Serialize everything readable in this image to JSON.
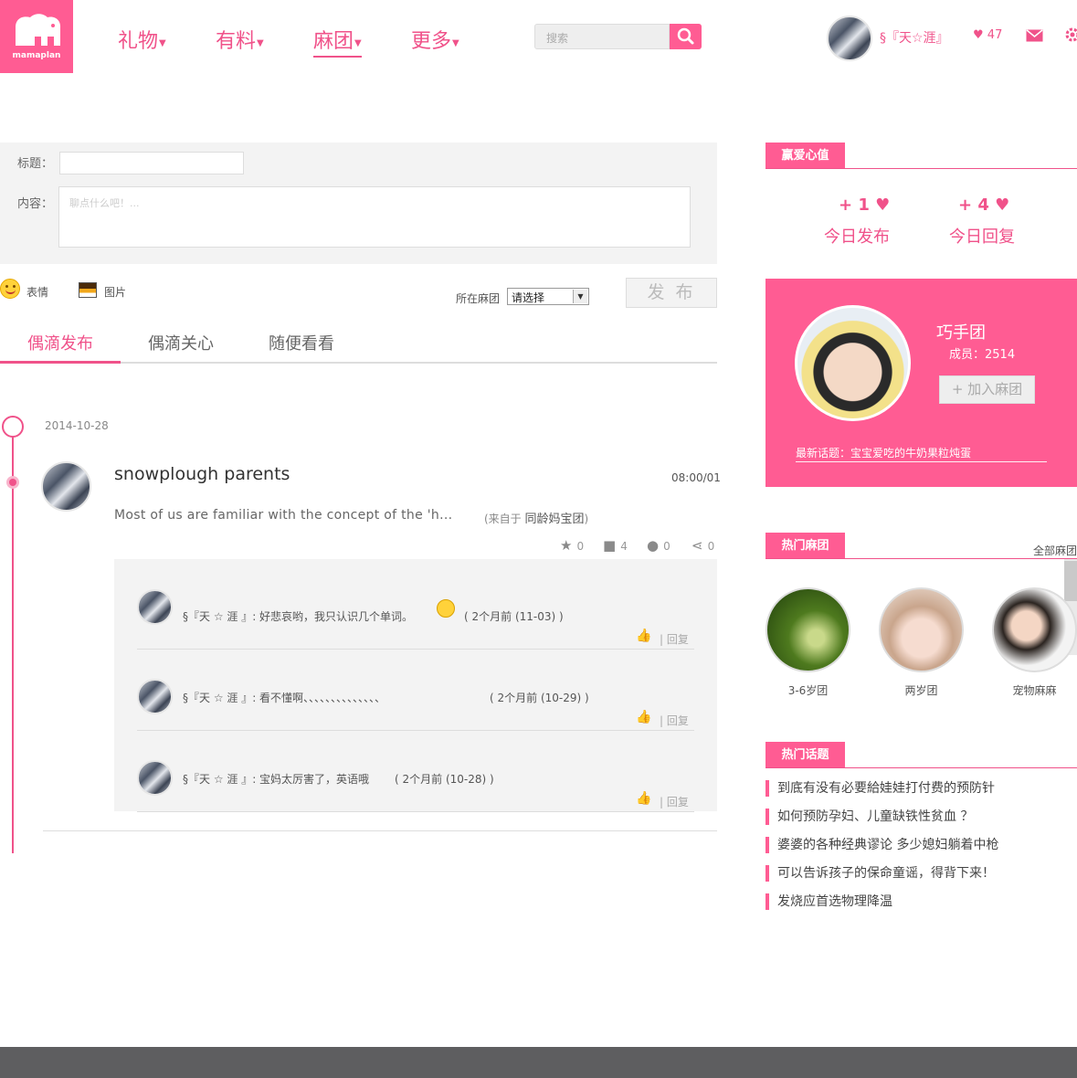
{
  "header": {
    "logo_text": "mamaplan",
    "nav": [
      {
        "label": "礼物"
      },
      {
        "label": "有料"
      },
      {
        "label": "麻团"
      },
      {
        "label": "更多"
      }
    ],
    "search_placeholder": "搜索",
    "user_name": "§『天☆涯』",
    "heart_count": "47",
    "accent": "#ff5c93"
  },
  "compose": {
    "title_label": "标题：",
    "content_label": "内容：",
    "content_placeholder": "聊点什么吧！...",
    "emoji_label": "表情",
    "image_label": "图片",
    "group_label": "所在麻团",
    "group_select": "请选择",
    "publish_label": "发 布"
  },
  "tabs": [
    "偶滴发布",
    "偶滴关心",
    "随便看看"
  ],
  "post": {
    "date": "2014-10-28",
    "title": "snowplough parents",
    "time": "08:00/01",
    "excerpt": "Most of us are familiar with the concept of the 'h...",
    "source_prefix": "(来自于",
    "source_group": "同龄妈宝团",
    "source_suffix": ")",
    "stats": {
      "favorites": "0",
      "comments": "4",
      "views": "0",
      "shares": "0"
    },
    "comments": [
      {
        "text": "§『天 ☆ 涯 』: 好悲哀哟，我只认识几个单词。",
        "time": "( 2个月前 (11-03) )",
        "reply": "| 回复"
      },
      {
        "text": "§『天 ☆ 涯 』: 看不懂啊、、、、、、、、、、、、、、",
        "time": "( 2个月前 (10-29) )",
        "reply": "| 回复"
      },
      {
        "text": "§『天 ☆ 涯 』: 宝妈太厉害了，英语哦",
        "time": "( 2个月前 (10-28) )",
        "reply": "| 回复"
      }
    ]
  },
  "sidebar": {
    "love_title": "赢爱心值",
    "today_post_value": "+ 1",
    "today_post_label": "今日发布",
    "today_reply_value": "+ 4",
    "today_reply_label": "今日回复",
    "group": {
      "name": "巧手团",
      "members": "成员：2514",
      "join_label": "+ 加入麻团",
      "latest_topic": "最新话题：宝宝爱吃的牛奶果粒炖蛋"
    },
    "hot_groups_title": "热门麻团",
    "all_groups_label": "全部麻团",
    "hot_groups": [
      {
        "label": "3-6岁团"
      },
      {
        "label": "两岁团"
      },
      {
        "label": "宠物麻麻"
      }
    ],
    "hot_topics_title": "热门话题",
    "hot_topics": [
      "到底有没有必要給娃娃打付费的预防针",
      "如何预防孕妇、儿童缺铁性贫血 ？",
      "婆婆的各种经典谬论 多少媳妇躺着中枪",
      "可以告诉孩子的保命童谣，得背下来！",
      "发烧应首选物理降温"
    ]
  }
}
